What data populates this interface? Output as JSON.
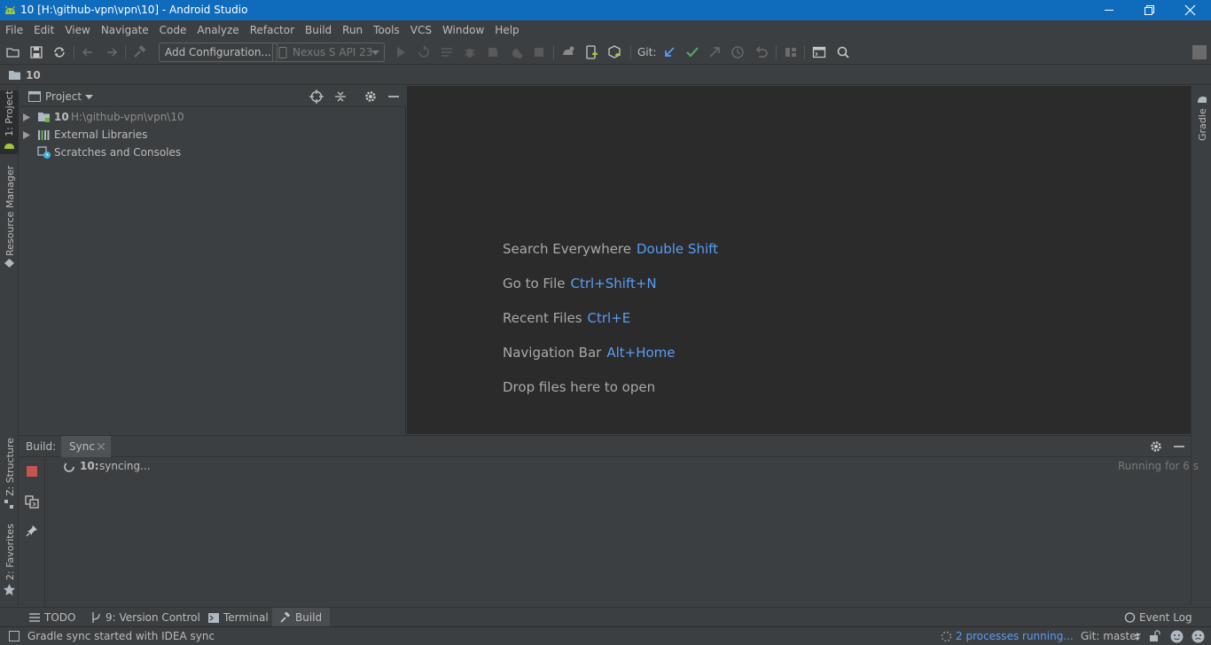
{
  "window": {
    "title": "10 [H:\\github-vpn\\vpn\\10] - Android Studio"
  },
  "menu": [
    "File",
    "Edit",
    "View",
    "Navigate",
    "Code",
    "Analyze",
    "Refactor",
    "Build",
    "Run",
    "Tools",
    "VCS",
    "Window",
    "Help"
  ],
  "toolbar": {
    "add_config_label": "Add Configuration...",
    "device_label": "Nexus S API 23",
    "git_label": "Git:"
  },
  "navbar": {
    "project": "10"
  },
  "left_stripe": {
    "project_tab": "1: Project",
    "resource_tab": "Resource Manager",
    "structure_tab": "Z: Structure",
    "favorites_tab": "2: Favorites"
  },
  "right_stripe": {
    "gradle_tab": "Gradle"
  },
  "project_panel": {
    "title": "Project",
    "tree": [
      {
        "name": "10",
        "path": "H:\\github-vpn\\vpn\\10"
      },
      {
        "name": "External Libraries"
      },
      {
        "name": "Scratches and Consoles"
      }
    ]
  },
  "editor_hints": [
    {
      "text": "Search Everywhere",
      "key": "Double Shift"
    },
    {
      "text": "Go to File",
      "key": "Ctrl+Shift+N"
    },
    {
      "text": "Recent Files",
      "key": "Ctrl+E"
    },
    {
      "text": "Navigation Bar",
      "key": "Alt+Home"
    },
    {
      "text": "Drop files here to open",
      "key": ""
    }
  ],
  "build_panel": {
    "label": "Build:",
    "tab": "Sync",
    "entry_name": "10:",
    "entry_status": "syncing...",
    "running": "Running for 6 s"
  },
  "bottom_tabs": {
    "todo": "TODO",
    "vcs": "9: Version Control",
    "terminal": "Terminal",
    "build": "Build",
    "event_log": "Event Log"
  },
  "status": {
    "message": "Gradle sync started with IDEA sync",
    "processes": "2 processes running...",
    "git_branch": "Git: master"
  },
  "colors": {
    "accent": "#589df6",
    "title_bar": "#0f6cbd",
    "editor_bg": "#2b2b2b",
    "panel_bg": "#3c3f41"
  }
}
